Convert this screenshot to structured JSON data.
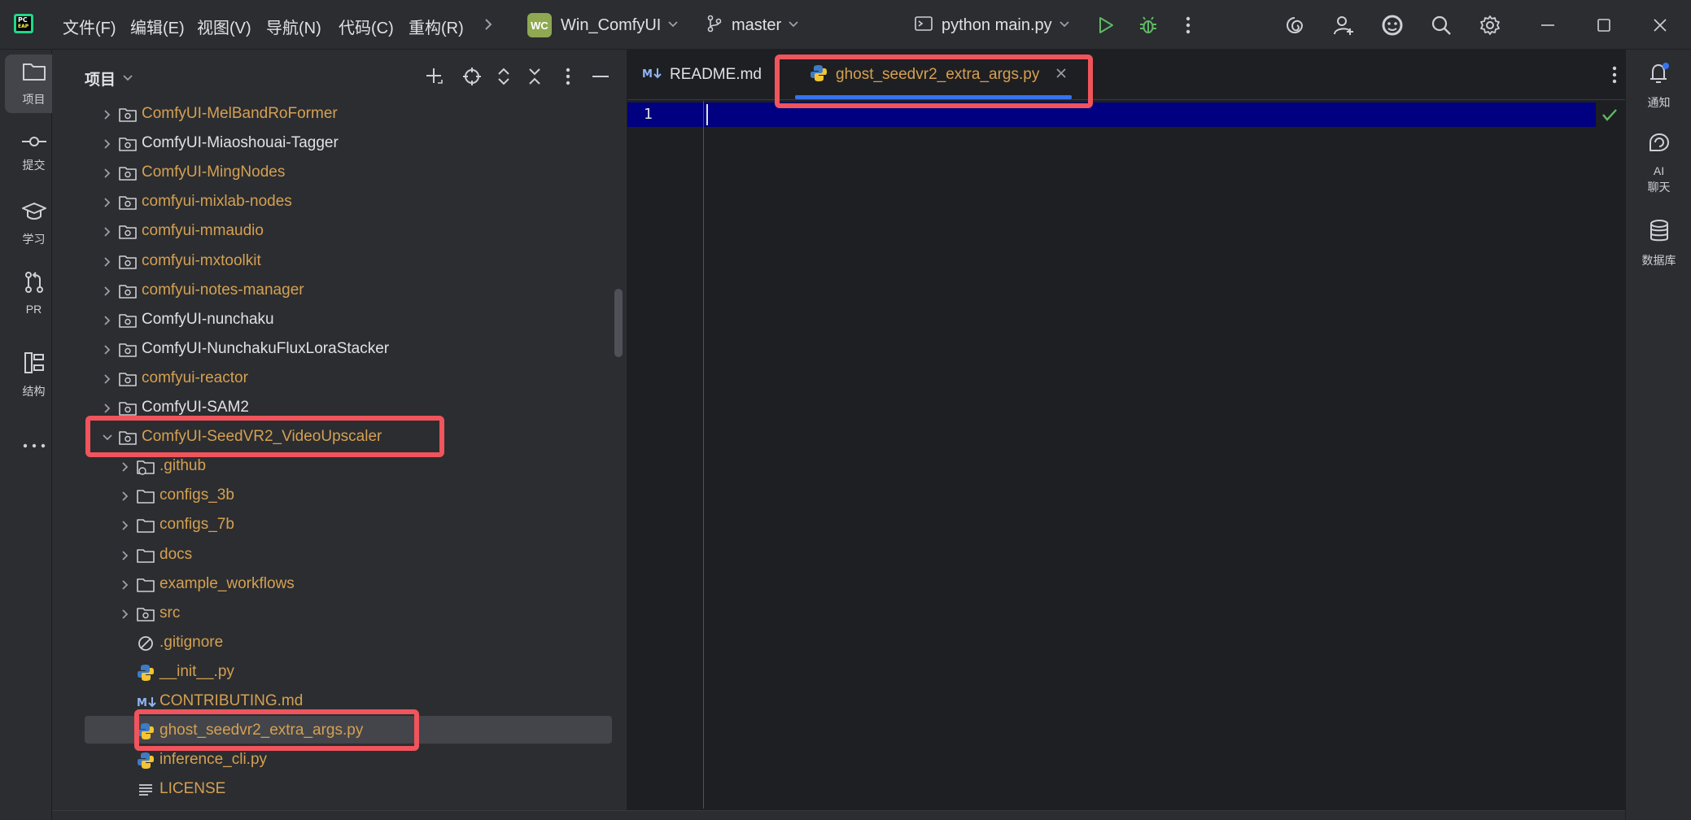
{
  "app": {
    "logo_text": "PC",
    "logo_sub": "EAP"
  },
  "menu": [
    "文件(F)",
    "编辑(E)",
    "视图(V)",
    "导航(N)",
    "代码(C)",
    "重构(R)"
  ],
  "toolbar": {
    "project_badge": "WC",
    "project_name": "Win_ComfyUI",
    "branch": "master",
    "run_config": "python main.py"
  },
  "left_strip": [
    {
      "label": "项目",
      "icon": "folder-icon"
    },
    {
      "label": "提交",
      "icon": "commit-icon"
    },
    {
      "label": "学习",
      "icon": "graduation-cap-icon"
    },
    {
      "label": "PR",
      "icon": "pull-request-icon"
    },
    {
      "label": "结构",
      "icon": "structure-icon"
    }
  ],
  "project_panel": {
    "title": "项目"
  },
  "tree": [
    {
      "label": "ComfyUI-MelBandRoFormer",
      "type": "module-folder",
      "color": "#d5a052",
      "expanded": false
    },
    {
      "label": "ComfyUI-Miaoshouai-Tagger",
      "type": "module-folder",
      "color": "#dfe1e5",
      "expanded": false
    },
    {
      "label": "ComfyUI-MingNodes",
      "type": "module-folder",
      "color": "#d5a052",
      "expanded": false
    },
    {
      "label": "comfyui-mixlab-nodes",
      "type": "module-folder",
      "color": "#d5a052",
      "expanded": false
    },
    {
      "label": "comfyui-mmaudio",
      "type": "module-folder",
      "color": "#d5a052",
      "expanded": false
    },
    {
      "label": "comfyui-mxtoolkit",
      "type": "module-folder",
      "color": "#d5a052",
      "expanded": false
    },
    {
      "label": "comfyui-notes-manager",
      "type": "module-folder",
      "color": "#d5a052",
      "expanded": false
    },
    {
      "label": "ComfyUI-nunchaku",
      "type": "module-folder",
      "color": "#dfe1e5",
      "expanded": false
    },
    {
      "label": "ComfyUI-NunchakuFluxLoraStacker",
      "type": "module-folder",
      "color": "#dfe1e5",
      "expanded": false
    },
    {
      "label": "comfyui-reactor",
      "type": "module-folder",
      "color": "#d5a052",
      "expanded": false
    },
    {
      "label": "ComfyUI-SAM2",
      "type": "module-folder",
      "color": "#dfe1e5",
      "expanded": false
    },
    {
      "label": "ComfyUI-SeedVR2_VideoUpscaler",
      "type": "module-folder",
      "color": "#d5a052",
      "expanded": true
    },
    {
      "label": ".github",
      "type": "git-folder",
      "color": "#d5a052",
      "expanded": false
    },
    {
      "label": "configs_3b",
      "type": "folder",
      "color": "#d5a052",
      "expanded": false
    },
    {
      "label": "configs_7b",
      "type": "folder",
      "color": "#d5a052",
      "expanded": false
    },
    {
      "label": "docs",
      "type": "folder",
      "color": "#d5a052",
      "expanded": false
    },
    {
      "label": "example_workflows",
      "type": "folder",
      "color": "#d5a052",
      "expanded": false
    },
    {
      "label": "src",
      "type": "module-folder",
      "color": "#d5a052",
      "expanded": false
    },
    {
      "label": ".gitignore",
      "type": "ignore-file",
      "color": "#d5a052"
    },
    {
      "label": "__init__.py",
      "type": "python-file",
      "color": "#d5a052"
    },
    {
      "label": "CONTRIBUTING.md",
      "type": "markdown-file",
      "color": "#d5a052"
    },
    {
      "label": "ghost_seedvr2_extra_args.py",
      "type": "python-file",
      "color": "#d5a052",
      "selected": true
    },
    {
      "label": "inference_cli.py",
      "type": "python-file",
      "color": "#d5a052"
    },
    {
      "label": "LICENSE",
      "type": "text-file",
      "color": "#d5a052"
    }
  ],
  "editor": {
    "tabs": [
      {
        "label": "README.md",
        "icon": "markdown-icon",
        "active": false,
        "color": "#dfe1e5"
      },
      {
        "label": "ghost_seedvr2_extra_args.py",
        "icon": "python-icon",
        "active": true,
        "color": "#d5a052"
      }
    ],
    "line_number": "1"
  },
  "right_strip": [
    {
      "label": "通知",
      "icon": "bell-icon"
    },
    {
      "label": "AI\n聊天",
      "icon": "ai-chat-icon"
    },
    {
      "label": "数据库",
      "icon": "database-icon"
    }
  ],
  "colors": {
    "accent": "#3574f0",
    "highlight": "#f0545c",
    "modified_file": "#d5a052",
    "current_line": "#000080"
  }
}
